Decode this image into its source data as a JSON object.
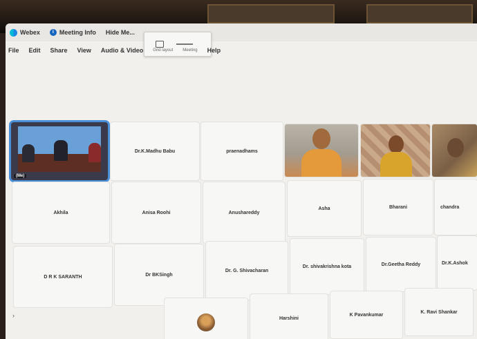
{
  "titlebar": {
    "app": "Webex",
    "meeting_info": "Meeting Info",
    "hide_menu": "Hide Me..."
  },
  "menu": {
    "items": [
      "File",
      "Edit",
      "Share",
      "View",
      "Audio & Video"
    ],
    "layout": "Grid layout",
    "meeting": "Meeting",
    "help": "Help"
  },
  "participants": {
    "self": "(Me)",
    "p1": "Dr.K.Madhu Babu",
    "p2": "praenadhams",
    "p3": "Akhila",
    "p4": "Anisa Roohi",
    "p5": "Anushareddy",
    "p6": "Asha",
    "p7": "Bharani",
    "p8": "chandra",
    "p9": "D R K SARANTH",
    "p10": "Dr BKSingh",
    "p11": "Dr. G. Shivacharan",
    "p12": "Dr. shivakrishna kota",
    "p13": "Dr.Geetha Reddy",
    "p14": "Dr.K.Ashok",
    "p15": "Harshini",
    "p16": "K Pavankumar",
    "p17": "K. Ravi Shankar"
  },
  "colors": {
    "accent": "#4a90d9",
    "tile_bg": "#f7f7f5",
    "screen_bg": "#f1f0ed"
  }
}
